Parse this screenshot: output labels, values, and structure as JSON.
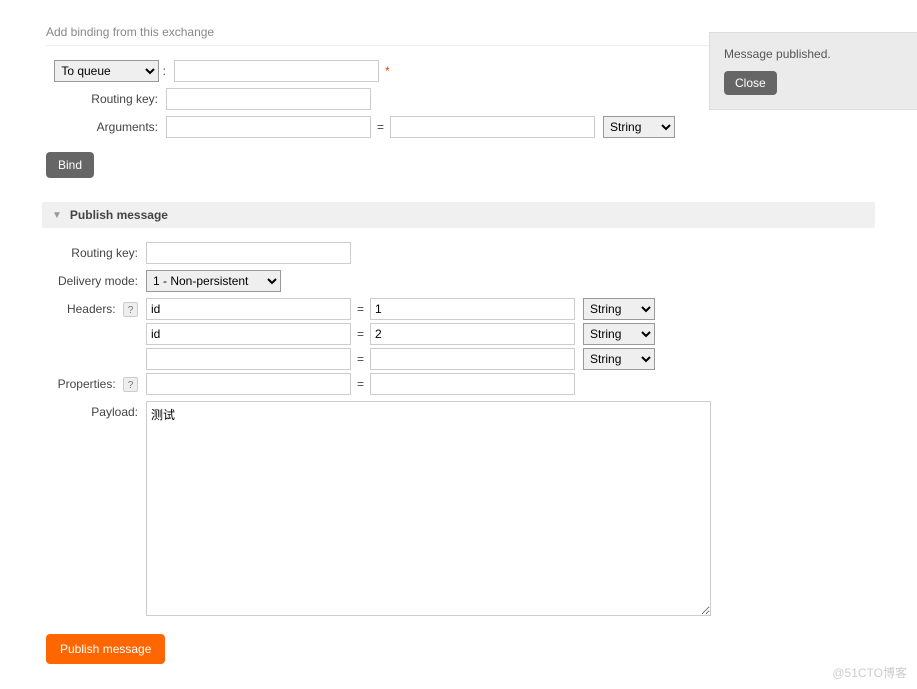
{
  "binding": {
    "title": "Add binding from this exchange",
    "destination_select": "To queue",
    "routing_label": "Routing key:",
    "arguments_label": "Arguments:",
    "arg_key": "",
    "arg_val": "",
    "arg_type": "String",
    "required_marker": "*",
    "bind_button": "Bind"
  },
  "publish": {
    "section_title": "Publish message",
    "routing_label": "Routing key:",
    "routing_value": "",
    "delivery_label": "Delivery mode:",
    "delivery_value": "1 - Non-persistent",
    "headers_label": "Headers:",
    "headers": [
      {
        "key": "id",
        "val": "1",
        "type": "String"
      },
      {
        "key": "id",
        "val": "2",
        "type": "String"
      },
      {
        "key": "",
        "val": "",
        "type": "String"
      }
    ],
    "properties_label": "Properties:",
    "prop_key": "",
    "prop_val": "",
    "payload_label": "Payload:",
    "payload_value": "测试",
    "publish_button": "Publish message",
    "help_text": "?"
  },
  "notification": {
    "message": "Message published.",
    "close": "Close"
  },
  "watermark": "@51CTO博客"
}
